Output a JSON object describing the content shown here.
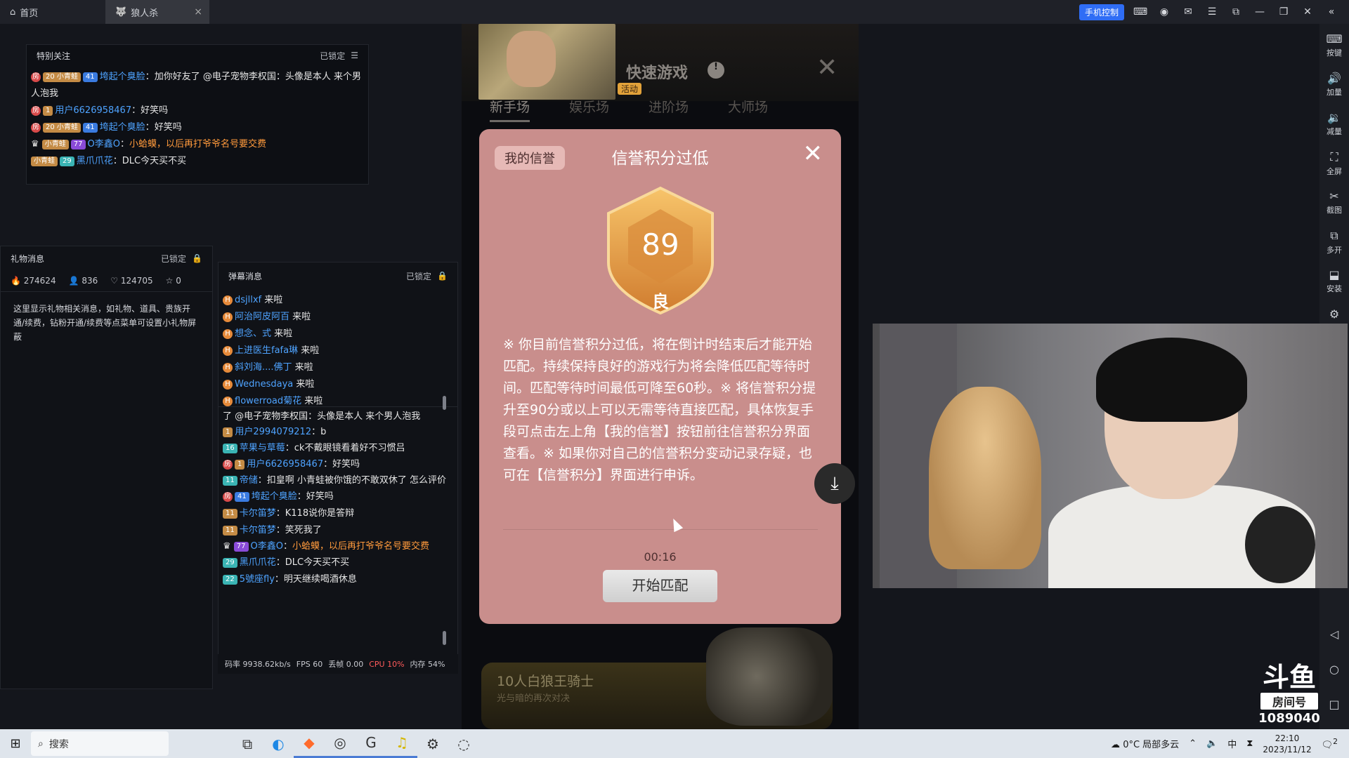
{
  "topbar": {
    "tabs": [
      {
        "label": "首页"
      },
      {
        "label": "狼人杀"
      }
    ],
    "phone_control": "手机控制"
  },
  "sidetools": [
    {
      "label": "按键",
      "icon": "keyboard-icon"
    },
    {
      "label": "加量",
      "icon": "volume-up-icon"
    },
    {
      "label": "减量",
      "icon": "volume-down-icon"
    },
    {
      "label": "全屏",
      "icon": "fullscreen-icon"
    },
    {
      "label": "截图",
      "icon": "scissors-icon"
    },
    {
      "label": "多开",
      "icon": "multi-open-icon"
    },
    {
      "label": "安装",
      "icon": "apk-install-icon"
    }
  ],
  "special": {
    "title": "特别关注",
    "lock": "已锁定",
    "messages": [
      {
        "level": "20",
        "fan": "小青蛙",
        "lvl2": "41",
        "user": "垮起个臭脸",
        "text": "加你好友了 @电子宠物李权国：头像是本人 来个男人泡我"
      },
      {
        "level": "",
        "fan": "",
        "lvl2": "1",
        "user": "用户6626958467",
        "text": "好笑吗"
      },
      {
        "level": "20",
        "fan": "小青蛙",
        "lvl2": "41",
        "user": "垮起个臭脸",
        "text": "好笑吗"
      },
      {
        "level": "",
        "fan": "小青蛙",
        "lvl2": "77",
        "user": "O李鑫O",
        "text": "小蛤蟆，以后再打爷爷名号要交费"
      },
      {
        "level": "",
        "fan": "小青蛙",
        "lvl2": "29",
        "user": "黑爪爪花",
        "text": "DLC今天买不买"
      }
    ]
  },
  "gift": {
    "title": "礼物消息",
    "lock": "已锁定",
    "stats": {
      "heat": "274624",
      "users": "836",
      "likes": "124705",
      "gifts": "0"
    },
    "desc": "这里显示礼物相关消息，如礼物、道具、贵族开通/续费，钻粉开通/续费等点菜单可设置小礼物屏蔽"
  },
  "danmu": {
    "title": "弹幕消息",
    "lock": "已锁定",
    "enters": [
      {
        "user": "dsjllxf",
        "text": "来啦"
      },
      {
        "user": "阿治阿皮阿百",
        "text": "来啦"
      },
      {
        "user": "想念、式",
        "text": "来啦"
      },
      {
        "user": "上进医生fafa琳",
        "text": "来啦"
      },
      {
        "user": "斜刘海....佛丁",
        "text": "来啦"
      },
      {
        "user": "Wednesdaya",
        "text": "来啦"
      },
      {
        "user": "flowerroad菊花",
        "text": "来啦"
      }
    ],
    "messages": [
      {
        "user": "",
        "text": "了 @电子宠物李权国：头像是本人 来个男人泡我"
      },
      {
        "lvl": "1",
        "user": "用户2994079212",
        "text": "b"
      },
      {
        "lvl": "16",
        "user": "苹果与草莓",
        "text": "ck不戴眼镜看着好不习惯吕"
      },
      {
        "lvl": "1",
        "user": "用户6626958467",
        "text": "好笑吗"
      },
      {
        "lvl": "11",
        "user": "帝储",
        "text": "扣皇啊 小青蛙被你饿的不敢双休了 怎么评价"
      },
      {
        "lvl": "41",
        "user": "垮起个臭脸",
        "text": "好笑吗"
      },
      {
        "lvl": "11",
        "user": "卡尔笛梦",
        "text": "K118说你是答辩"
      },
      {
        "lvl": "11",
        "user": "卡尔笛梦",
        "text": "笑死我了"
      },
      {
        "lvl": "77",
        "user": "O李鑫O",
        "text": "小蛤蟆，以后再打爷爷名号要交费"
      },
      {
        "lvl": "29",
        "user": "黑爪爪花",
        "text": "DLC今天买不买"
      },
      {
        "lvl": "22",
        "user": "5號座fly",
        "text": "明天继续喝酒休息"
      }
    ],
    "status": {
      "bitrate": "码率 9938.62kb/s",
      "fps": "FPS 60",
      "drop": "丢帧 0.00",
      "cpu": "CPU 10%",
      "mem": "内存 54%"
    }
  },
  "game": {
    "activity": "活动",
    "quick_title": "快速游戏",
    "tabs": [
      "新手场",
      "娱乐场",
      "进阶场",
      "大师场"
    ],
    "bottom_title": "10人白狼王骑士",
    "bottom_sub": "光与暗的再次对决"
  },
  "modal": {
    "my_credit": "我的信誉",
    "title": "信誉积分过低",
    "score": "89",
    "grade": "良",
    "text": "※ 你目前信誉积分过低，将在倒计时结束后才能开始匹配。持续保持良好的游戏行为将会降低匹配等待时间。匹配等待时间最低可降至60秒。※ 将信誉积分提升至90分或以上可以无需等待直接匹配，具体恢复手段可点击左上角【我的信誉】按钮前往信誉积分界面查看。※ 如果你对自己的信誉积分变动记录存疑，也可在【信誉积分】界面进行申诉。",
    "countdown": "00:16",
    "start": "开始匹配"
  },
  "douyu": {
    "logo": "斗鱼",
    "room_label": "房间号",
    "room_number": "1089040"
  },
  "taskbar": {
    "search": "搜索",
    "weather": "0°C 局部多云",
    "time": "22:10",
    "date": "2023/11/12",
    "ime": "中",
    "notif_count": "2"
  }
}
